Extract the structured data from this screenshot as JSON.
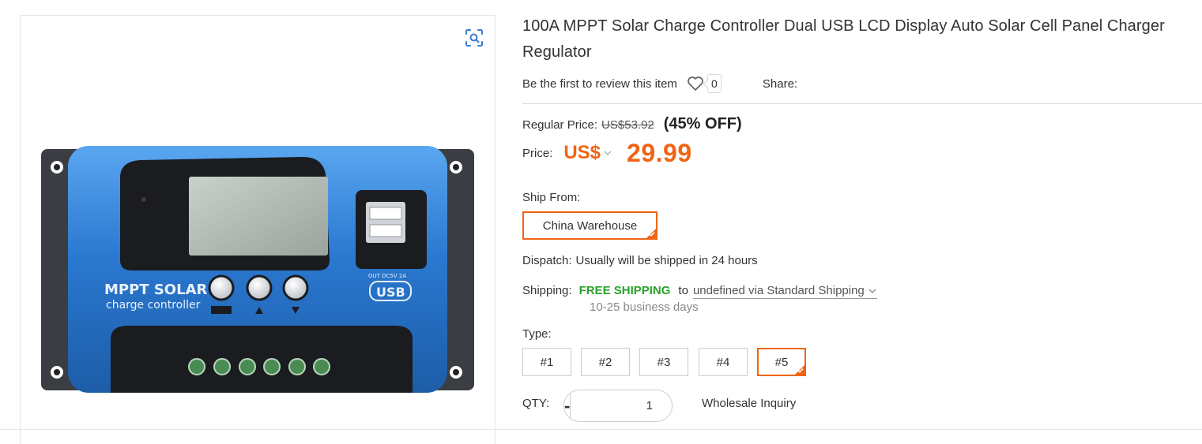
{
  "product": {
    "title": "100A MPPT Solar Charge Controller Dual USB LCD Display Auto Solar Cell Panel Charger Regulator",
    "image_alt": "MPPT solar charge controller",
    "device_brand_text": "MPPT SOLAR",
    "device_sub_text": "charge controller",
    "device_usb_text": "USB",
    "device_out_text": "OUT DC5V 2A"
  },
  "review": {
    "link_text": "Be the first to review this item",
    "wishlist_count": "0",
    "share_label": "Share:"
  },
  "pricing": {
    "regular_label": "Regular Price:",
    "regular_price": "US$53.92",
    "discount": "(45% OFF)",
    "price_label": "Price:",
    "currency": "US$",
    "price": "29.99"
  },
  "ship_from": {
    "label": "Ship From:",
    "selected": "China Warehouse"
  },
  "dispatch": {
    "label": "Dispatch:",
    "value": "Usually will be shipped in 24 hours"
  },
  "shipping": {
    "label": "Shipping:",
    "free_text": "FREE SHIPPING",
    "to_text": "to",
    "method": "undefined via Standard Shipping",
    "delivery_time": "10-25 business days"
  },
  "type": {
    "label": "Type:",
    "options": [
      "#1",
      "#2",
      "#3",
      "#4",
      "#5"
    ],
    "selected": "#5"
  },
  "quantity": {
    "label": "QTY:",
    "minus": "-",
    "value": "1",
    "plus": "+",
    "wholesale_link": "Wholesale Inquiry"
  },
  "colors": {
    "accent_orange": "#f06414",
    "free_shipping_green": "#29a329",
    "device_blue": "#2f7fd6"
  },
  "icons": {
    "zoom": "scan-zoom-icon",
    "wishlist": "heart-icon",
    "dropdown": "chevron-down-icon"
  }
}
